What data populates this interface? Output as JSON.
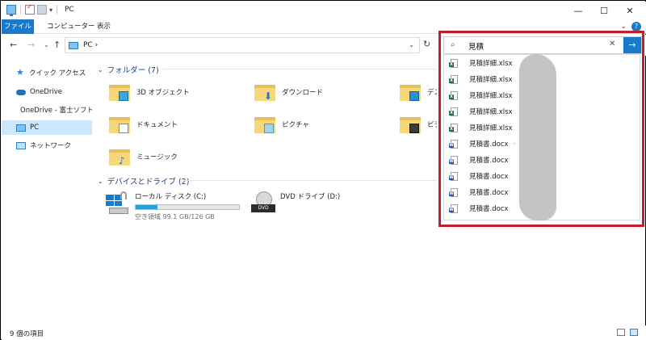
{
  "window": {
    "title": "PC",
    "minimize": "—",
    "maximize": "☐",
    "close": "✕",
    "qa_dropdown": "▾"
  },
  "ribbon": {
    "tabs": [
      "ファイル",
      "コンピューター",
      "表示"
    ],
    "collapse_chevron": "⌄",
    "help": "?"
  },
  "address": {
    "back": "←",
    "forward": "→",
    "history_dropdown": "⌄",
    "up": "↑",
    "path": "PC  ›",
    "dropdown": "⌄",
    "refresh": "↻"
  },
  "search": {
    "icon": "⌕",
    "value": "見積",
    "clear": "✕",
    "go": "→",
    "suggestions": [
      {
        "name": "見積詳細.xlsx",
        "type": "xlsx"
      },
      {
        "name": "見積詳細.xlsx",
        "type": "xlsx"
      },
      {
        "name": "見積詳細.xlsx",
        "type": "xlsx"
      },
      {
        "name": "見積詳細.xlsx",
        "type": "xlsx"
      },
      {
        "name": "見積詳細.xlsx",
        "type": "xlsx"
      },
      {
        "name": "見積書.docx",
        "type": "docx"
      },
      {
        "name": "見積書.docx",
        "type": "docx"
      },
      {
        "name": "見積書.docx",
        "type": "docx"
      },
      {
        "name": "見積書.docx",
        "type": "docx"
      },
      {
        "name": "見積書.docx",
        "type": "docx"
      }
    ],
    "dash": "-"
  },
  "nav": {
    "items": [
      {
        "label": "クイック アクセス",
        "icon": "star-icon"
      },
      {
        "label": "OneDrive",
        "icon": "cloud-icon"
      },
      {
        "label": "OneDrive - 富士ソフト株式会社",
        "icon": "cloud-icon"
      },
      {
        "label": "PC",
        "icon": "pc-icon"
      },
      {
        "label": "ネットワーク",
        "icon": "network-icon"
      }
    ]
  },
  "folders": {
    "header": "フォルダー (7)",
    "chevron": "⌄",
    "items": [
      {
        "label": "3D オブジェクト"
      },
      {
        "label": "ダウンロード"
      },
      {
        "label": "デスクトップ"
      },
      {
        "label": "ドキュメント"
      },
      {
        "label": "ピクチャ"
      },
      {
        "label": "ビデオ"
      },
      {
        "label": "ミュージック"
      }
    ]
  },
  "drives": {
    "header": "デバイスとドライブ (2)",
    "chevron": "⌄",
    "items": [
      {
        "label": "ローカル ディスク (C:)",
        "free": "空き領域 99.1 GB/126 GB",
        "used_fraction": 0.214
      },
      {
        "label": "DVD ドライブ (D:)",
        "badge": "DVD"
      }
    ]
  },
  "status": {
    "count": "9 個の項目"
  },
  "colors": {
    "accent": "#1979ca",
    "highlight": "#c0202a",
    "selection": "#cce8ff"
  }
}
